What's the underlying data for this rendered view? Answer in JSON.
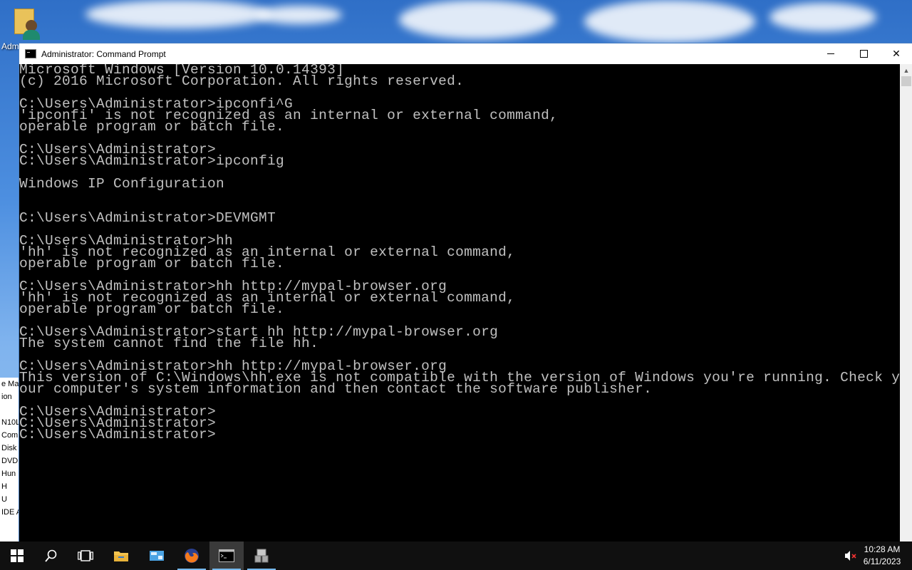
{
  "desktop": {
    "icon_label": "Adm",
    "bg_window_rows": [
      "e Ma",
      "ion",
      "",
      "N10L",
      "Com",
      "Disk",
      "DVD",
      "Hun",
      "H",
      "U",
      "IDE A"
    ]
  },
  "window": {
    "title": "Administrator: Command Prompt",
    "minimize_symbol": "—",
    "maximize_symbol": "☐",
    "close_symbol": "✕"
  },
  "console": {
    "lines": [
      "Microsoft Windows [Version 10.0.14393]",
      "(c) 2016 Microsoft Corporation. All rights reserved.",
      "",
      "C:\\Users\\Administrator>ipconfi^G",
      "'ipconfi' is not recognized as an internal or external command,",
      "operable program or batch file.",
      "",
      "C:\\Users\\Administrator>",
      "C:\\Users\\Administrator>ipconfig",
      "",
      "Windows IP Configuration",
      "",
      "",
      "C:\\Users\\Administrator>DEVMGMT",
      "",
      "C:\\Users\\Administrator>hh",
      "'hh' is not recognized as an internal or external command,",
      "operable program or batch file.",
      "",
      "C:\\Users\\Administrator>hh http://mypal-browser.org",
      "'hh' is not recognized as an internal or external command,",
      "operable program or batch file.",
      "",
      "C:\\Users\\Administrator>start hh http://mypal-browser.org",
      "The system cannot find the file hh.",
      "",
      "C:\\Users\\Administrator>hh http://mypal-browser.org",
      "This version of C:\\Windows\\hh.exe is not compatible with the version of Windows you're running. Check y",
      "our computer's system information and then contact the software publisher.",
      "",
      "C:\\Users\\Administrator>",
      "C:\\Users\\Administrator>",
      "C:\\Users\\Administrator>"
    ]
  },
  "taskbar": {
    "items": [
      "start-icon",
      "search-icon",
      "task-view-icon",
      "file-explorer-icon",
      "server-manager-icon",
      "firefox-icon",
      "command-prompt-icon",
      "network-app-icon"
    ],
    "time": "10:28 AM",
    "date": "6/11/2023"
  },
  "colors": {
    "console_bg": "#000000",
    "console_fg": "#c0c0c0",
    "taskbar_bg": "#101010",
    "accent": "#76b9ed"
  }
}
